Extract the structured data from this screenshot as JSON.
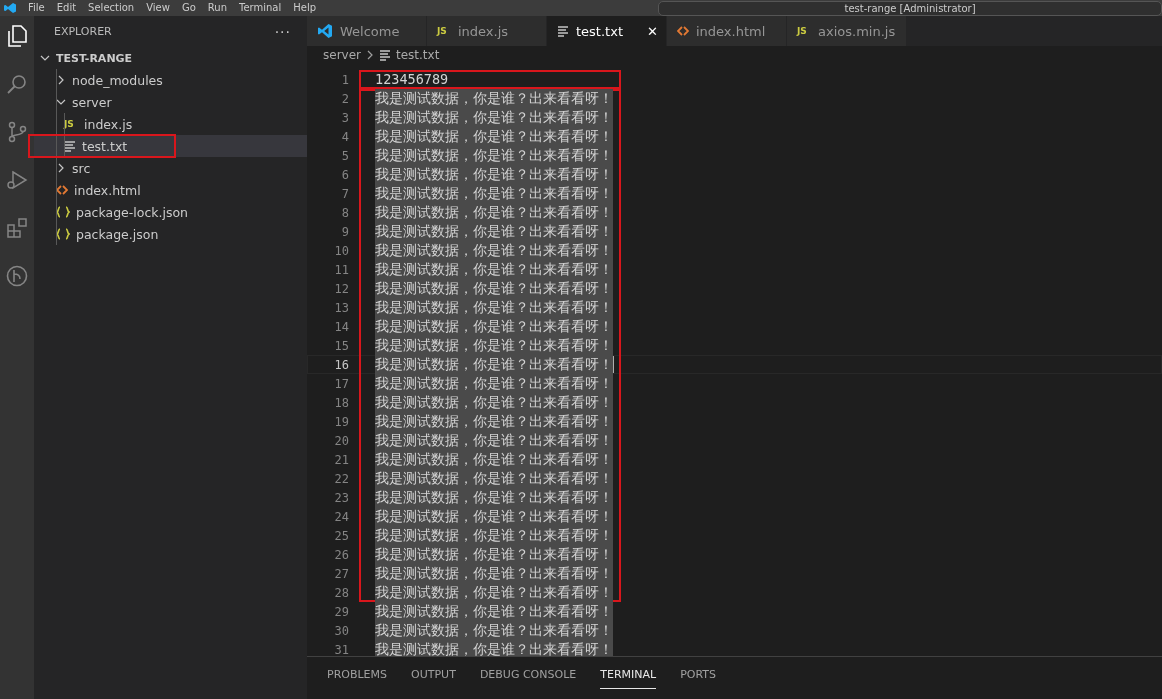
{
  "menu_bar": {
    "items": [
      "File",
      "Edit",
      "Selection",
      "View",
      "Go",
      "Run",
      "Terminal",
      "Help"
    ],
    "command_center": "test-range [Administrator]"
  },
  "activity_bar": {
    "items": [
      {
        "kind": "files",
        "selected": true
      },
      {
        "kind": "search",
        "selected": false
      },
      {
        "kind": "source-control",
        "selected": false
      },
      {
        "kind": "run",
        "selected": false
      },
      {
        "kind": "extensions",
        "selected": false
      },
      {
        "kind": "graph",
        "selected": false
      }
    ]
  },
  "sidebar": {
    "title": "EXPLORER",
    "more": "···",
    "root": {
      "label": "TEST-RANGE",
      "expanded": true
    },
    "items": [
      {
        "label": "node_modules",
        "kind": "folder",
        "expanded": false,
        "selected": false,
        "boxed": false
      },
      {
        "label": "server",
        "kind": "folder",
        "expanded": true,
        "selected": false,
        "boxed": false,
        "children": [
          {
            "label": "index.js",
            "kind": "js",
            "badge": "JS",
            "selected": false,
            "boxed": false
          },
          {
            "label": "test.txt",
            "kind": "txt",
            "selected": true,
            "boxed": true
          }
        ]
      },
      {
        "label": "src",
        "kind": "folder",
        "expanded": false,
        "selected": false,
        "boxed": false
      },
      {
        "label": "index.html",
        "kind": "html",
        "selected": false,
        "boxed": false
      },
      {
        "label": "package-lock.json",
        "kind": "json",
        "selected": false,
        "boxed": false
      },
      {
        "label": "package.json",
        "kind": "json",
        "selected": false,
        "boxed": false
      }
    ]
  },
  "tabs": [
    {
      "label": "Welcome",
      "kind": "welcome",
      "selected": false
    },
    {
      "label": "index.js",
      "kind": "js",
      "badge": "JS",
      "selected": false
    },
    {
      "label": "test.txt",
      "kind": "txt",
      "selected": true,
      "close": "✕"
    },
    {
      "label": "index.html",
      "kind": "html",
      "selected": false
    },
    {
      "label": "axios.min.js",
      "kind": "js",
      "badge": "JS",
      "selected": false
    }
  ],
  "breadcrumb": [
    {
      "label": "server",
      "kind": "folder"
    },
    {
      "label": "test.txt",
      "kind": "txt"
    }
  ],
  "editor": {
    "lines": [
      {
        "number": "1",
        "text": "123456789",
        "selected": false,
        "current": false,
        "framed": true,
        "frame_start": true
      },
      {
        "number": "2",
        "text": "我是测试数据，你是谁？出来看看呀！",
        "selected": true,
        "current": false,
        "framed": true,
        "frame_start": true
      },
      {
        "number": "3",
        "text": "我是测试数据，你是谁？出来看看呀！",
        "selected": true,
        "current": false,
        "framed": true,
        "frame_start": false
      },
      {
        "number": "4",
        "text": "我是测试数据，你是谁？出来看看呀！",
        "selected": true,
        "current": false,
        "framed": true,
        "frame_start": false
      },
      {
        "number": "5",
        "text": "我是测试数据，你是谁？出来看看呀！",
        "selected": true,
        "current": false,
        "framed": true,
        "frame_start": false
      },
      {
        "number": "6",
        "text": "我是测试数据，你是谁？出来看看呀！",
        "selected": true,
        "current": false,
        "framed": true,
        "frame_start": false
      },
      {
        "number": "7",
        "text": "我是测试数据，你是谁？出来看看呀！",
        "selected": true,
        "current": false,
        "framed": true,
        "frame_start": false
      },
      {
        "number": "8",
        "text": "我是测试数据，你是谁？出来看看呀！",
        "selected": true,
        "current": false,
        "framed": true,
        "frame_start": false
      },
      {
        "number": "9",
        "text": "我是测试数据，你是谁？出来看看呀！",
        "selected": true,
        "current": false,
        "framed": true,
        "frame_start": false
      },
      {
        "number": "10",
        "text": "我是测试数据，你是谁？出来看看呀！",
        "selected": true,
        "current": false,
        "framed": true,
        "frame_start": false
      },
      {
        "number": "11",
        "text": "我是测试数据，你是谁？出来看看呀！",
        "selected": true,
        "current": false,
        "framed": true,
        "frame_start": false
      },
      {
        "number": "12",
        "text": "我是测试数据，你是谁？出来看看呀！",
        "selected": true,
        "current": false,
        "framed": true,
        "frame_start": false
      },
      {
        "number": "13",
        "text": "我是测试数据，你是谁？出来看看呀！",
        "selected": true,
        "current": false,
        "framed": true,
        "frame_start": false
      },
      {
        "number": "14",
        "text": "我是测试数据，你是谁？出来看看呀！",
        "selected": true,
        "current": false,
        "framed": true,
        "frame_start": false
      },
      {
        "number": "15",
        "text": "我是测试数据，你是谁？出来看看呀！",
        "selected": true,
        "current": false,
        "framed": true,
        "frame_start": false
      },
      {
        "number": "16",
        "text": "我是测试数据，你是谁？出来看看呀！",
        "selected": true,
        "current": true,
        "framed": true,
        "frame_start": false
      },
      {
        "number": "17",
        "text": "我是测试数据，你是谁？出来看看呀！",
        "selected": true,
        "current": false,
        "framed": true,
        "frame_start": false
      },
      {
        "number": "18",
        "text": "我是测试数据，你是谁？出来看看呀！",
        "selected": true,
        "current": false,
        "framed": true,
        "frame_start": false
      },
      {
        "number": "19",
        "text": "我是测试数据，你是谁？出来看看呀！",
        "selected": true,
        "current": false,
        "framed": true,
        "frame_start": false
      },
      {
        "number": "20",
        "text": "我是测试数据，你是谁？出来看看呀！",
        "selected": true,
        "current": false,
        "framed": true,
        "frame_start": false
      },
      {
        "number": "21",
        "text": "我是测试数据，你是谁？出来看看呀！",
        "selected": true,
        "current": false,
        "framed": true,
        "frame_start": false
      },
      {
        "number": "22",
        "text": "我是测试数据，你是谁？出来看看呀！",
        "selected": true,
        "current": false,
        "framed": true,
        "frame_start": false
      },
      {
        "number": "23",
        "text": "我是测试数据，你是谁？出来看看呀！",
        "selected": true,
        "current": false,
        "framed": true,
        "frame_start": false
      },
      {
        "number": "24",
        "text": "我是测试数据，你是谁？出来看看呀！",
        "selected": true,
        "current": false,
        "framed": true,
        "frame_start": false
      },
      {
        "number": "25",
        "text": "我是测试数据，你是谁？出来看看呀！",
        "selected": true,
        "current": false,
        "framed": true,
        "frame_start": false
      },
      {
        "number": "26",
        "text": "我是测试数据，你是谁？出来看看呀！",
        "selected": true,
        "current": false,
        "framed": true,
        "frame_start": false
      },
      {
        "number": "27",
        "text": "我是测试数据，你是谁？出来看看呀！",
        "selected": true,
        "current": false,
        "framed": true,
        "frame_start": false
      },
      {
        "number": "28",
        "text": "我是测试数据，你是谁？出来看看呀！",
        "selected": true,
        "current": false,
        "framed": true,
        "frame_start": false
      },
      {
        "number": "29",
        "text": "我是测试数据，你是谁？出来看看呀！",
        "selected": true,
        "current": false,
        "framed": false
      },
      {
        "number": "30",
        "text": "我是测试数据，你是谁？出来看看呀！",
        "selected": true,
        "current": false,
        "framed": false
      },
      {
        "number": "31",
        "text": "我是测试数据，你是谁？出来看看呀！",
        "selected": true,
        "current": false,
        "framed": false
      }
    ]
  },
  "panel": {
    "tabs": [
      {
        "label": "PROBLEMS",
        "selected": false
      },
      {
        "label": "OUTPUT",
        "selected": false
      },
      {
        "label": "DEBUG CONSOLE",
        "selected": false
      },
      {
        "label": "TERMINAL",
        "selected": true
      },
      {
        "label": "PORTS",
        "selected": false
      }
    ]
  }
}
